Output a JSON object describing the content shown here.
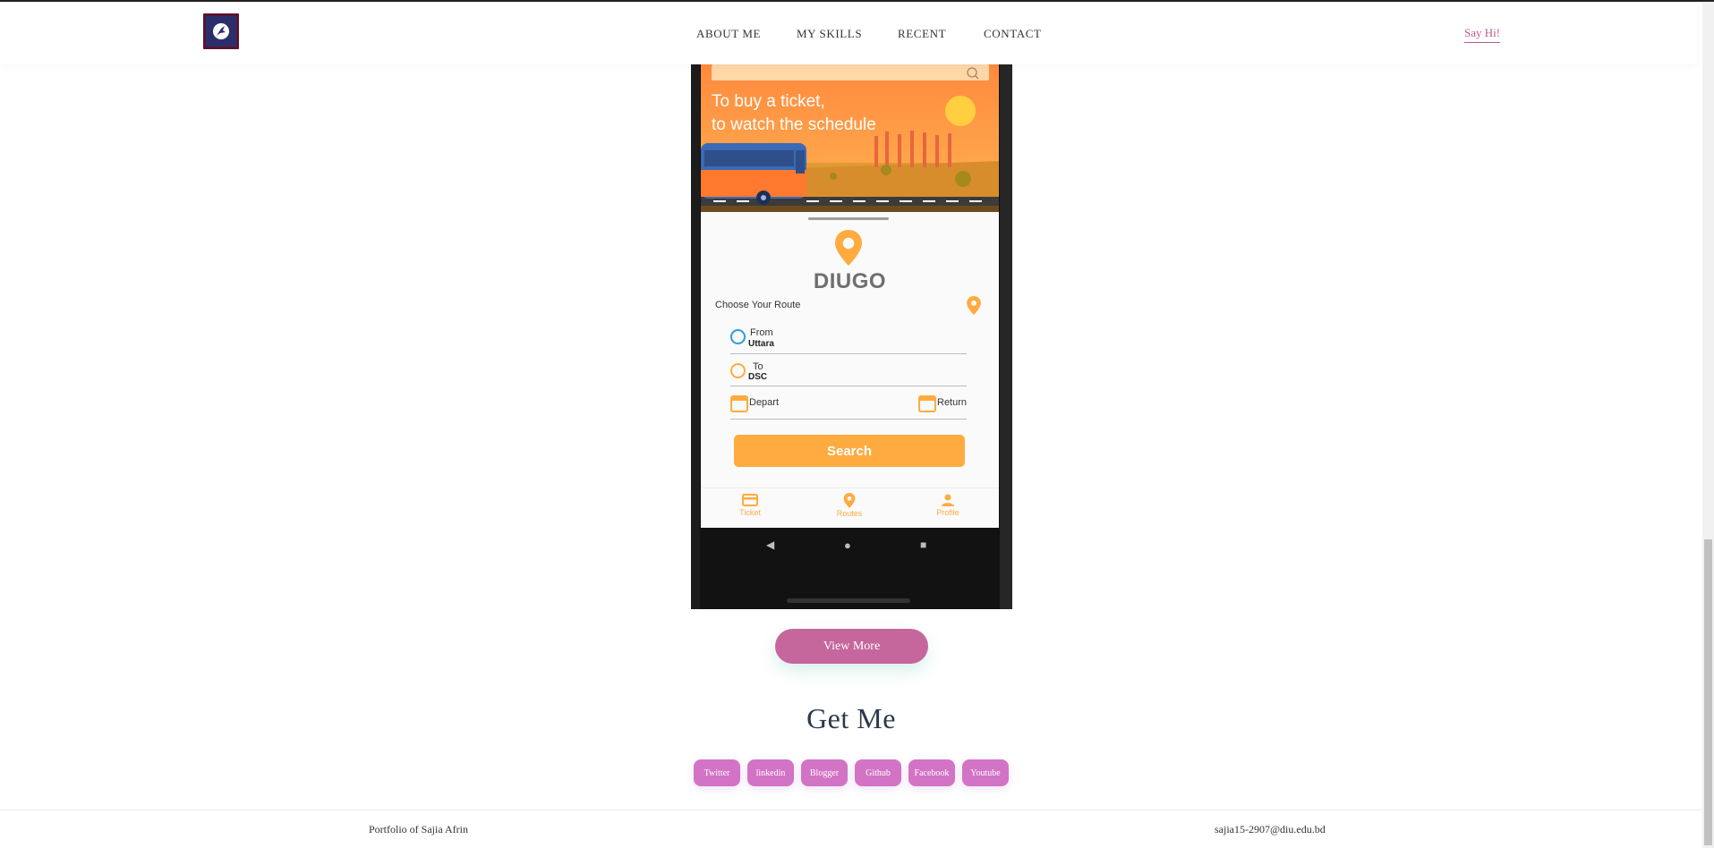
{
  "header": {
    "nav": [
      "ABOUT ME",
      "MY SKILLS",
      "RECENT",
      "CONTACT"
    ],
    "cta": "Say Hi!"
  },
  "phone": {
    "banner_line1": "To buy a ticket,",
    "banner_line2": "to watch the schedule",
    "app_name": "DIUGO",
    "route_label": "Choose Your Route",
    "from_label": "From",
    "from_value": "Uttara",
    "to_label": "To",
    "to_value": "DSC",
    "depart_label": "Depart",
    "return_label": "Return",
    "search_label": "Search",
    "bottom_nav": [
      "Ticket",
      "Routes",
      "Profile"
    ],
    "accent": "#ffab40",
    "from_color": "#2d9cdb"
  },
  "view_more": "View More",
  "get_me": {
    "title": "Get Me",
    "links": [
      "Twitter",
      "linkedin",
      "Blogger",
      "Github",
      "Facebook",
      "Youtube"
    ]
  },
  "footer": {
    "left": "Portfolio of Sajia Afrin",
    "right": "sajia15-2907@diu.edu.bd"
  },
  "colors": {
    "pink_button": "#c5669c",
    "social_button": "#d373c5",
    "say_hi": "#c0588f"
  }
}
